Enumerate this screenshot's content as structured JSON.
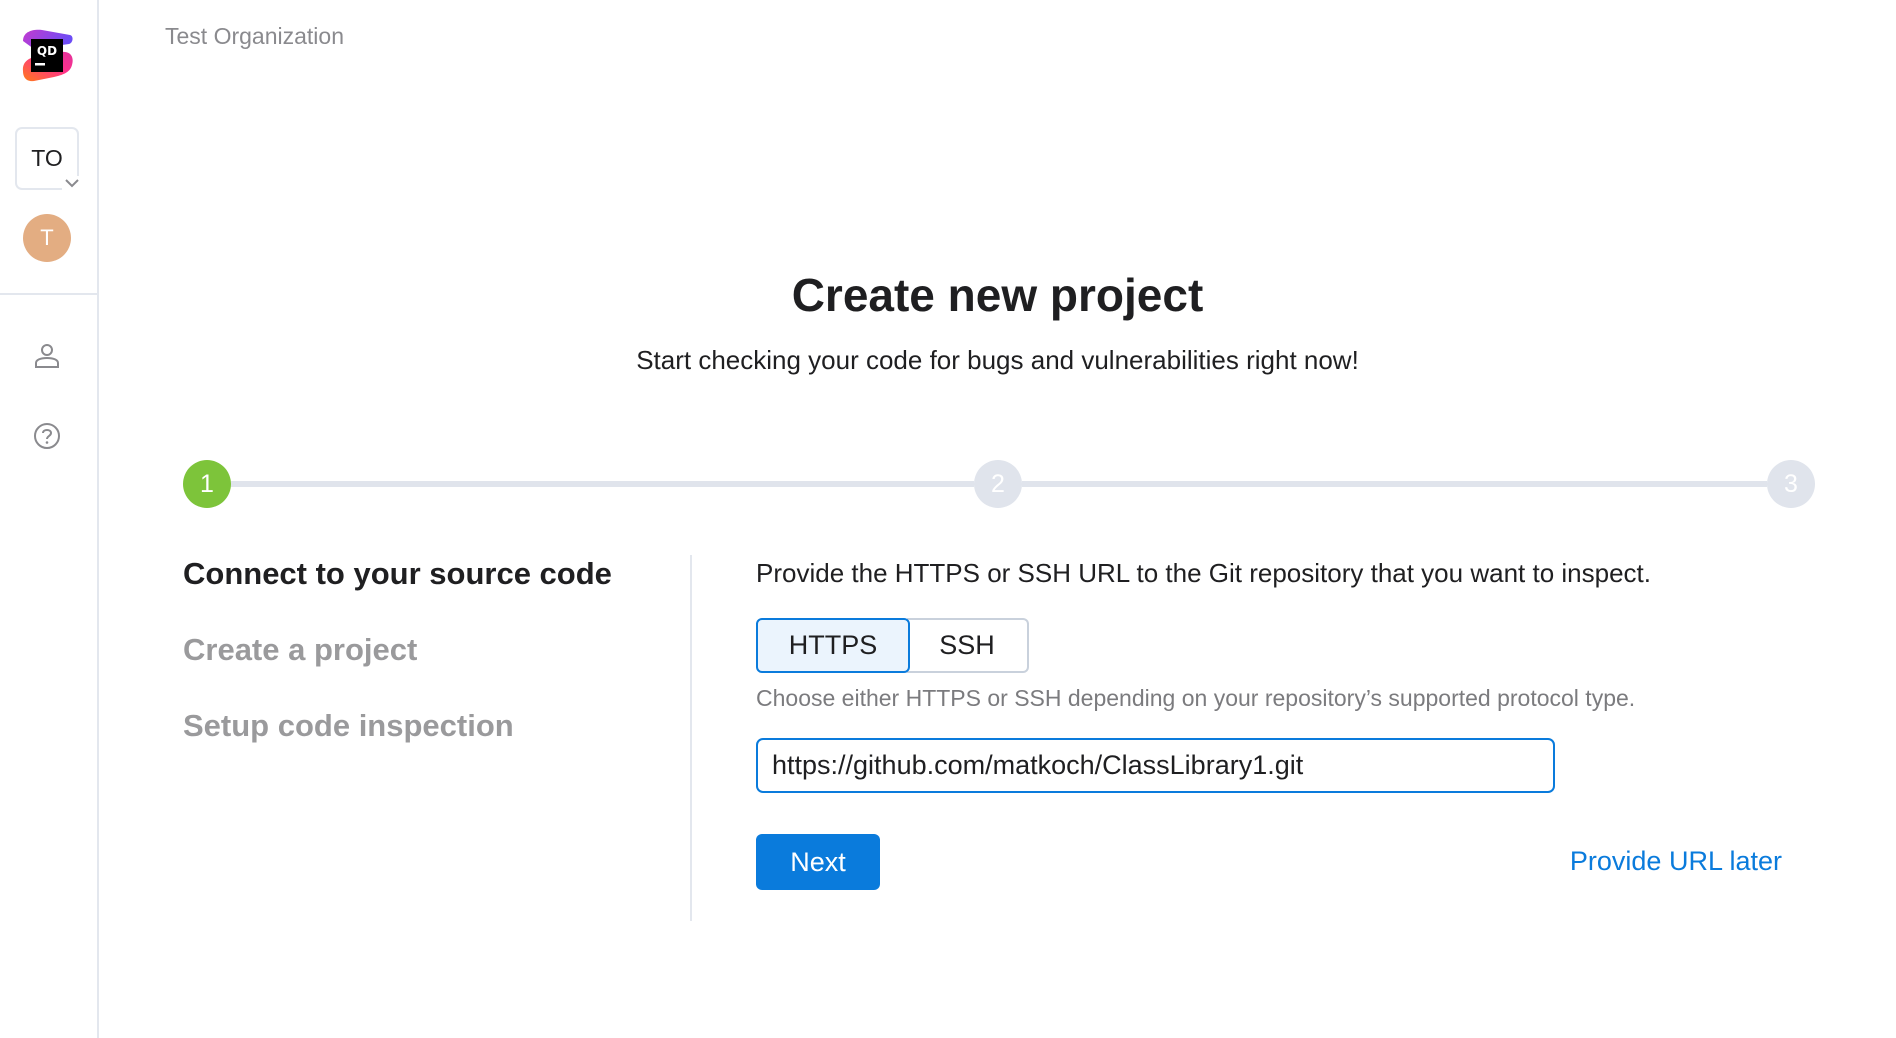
{
  "sidebar": {
    "logo_text": "QD",
    "logo_icon": "qodana-logo-icon",
    "org_initials": "TO",
    "org_chevron_icon": "chevron-down-icon",
    "avatar_initial": "T",
    "avatar_color": "#e3ad82",
    "nav_icons": [
      "user-icon",
      "help-icon"
    ]
  },
  "header": {
    "org_name": "Test Organization"
  },
  "main": {
    "title": "Create new project",
    "subtitle": "Start checking your code for bugs and vulnerabilities right now!",
    "stepper": {
      "steps": [
        {
          "number": "1",
          "state": "active"
        },
        {
          "number": "2",
          "state": "inactive"
        },
        {
          "number": "3",
          "state": "inactive"
        }
      ],
      "active_color": "#7dc43a",
      "inactive_color": "#e0e4ec"
    },
    "step_labels": [
      {
        "label": "Connect to your source code",
        "state": "current"
      },
      {
        "label": "Create a project",
        "state": "pending"
      },
      {
        "label": "Setup code inspection",
        "state": "pending"
      }
    ],
    "form": {
      "instruction": "Provide the HTTPS or SSH URL to the Git repository that you want to inspect.",
      "protocol_options": [
        "HTTPS",
        "SSH"
      ],
      "selected_protocol": "HTTPS",
      "hint": "Choose either HTTPS or SSH depending on your repository’s supported protocol type.",
      "url_value": "https://github.com/matkoch/ClassLibrary1.git",
      "next_label": "Next",
      "later_label": "Provide URL later",
      "accent_color": "#0a7bdc"
    }
  }
}
